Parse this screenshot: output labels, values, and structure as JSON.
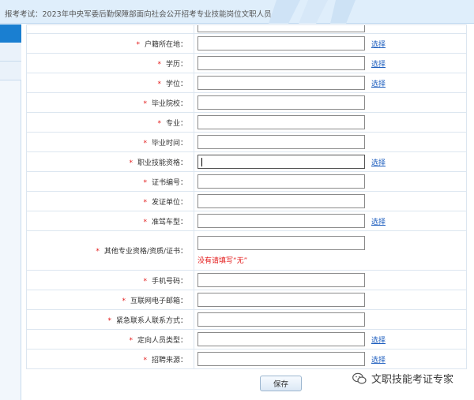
{
  "header": {
    "title": "报考考试：2023年中央军委后勤保障部面向社会公开招考专业技能岗位文职人员"
  },
  "form": {
    "rows": [
      {
        "label": "户籍所在地：",
        "required": true,
        "action": "选择"
      },
      {
        "label": "学历：",
        "required": true,
        "action": "选择"
      },
      {
        "label": "学位：",
        "required": true,
        "action": "选择"
      },
      {
        "label": "毕业院校：",
        "required": true,
        "action": ""
      },
      {
        "label": "专业：",
        "required": true,
        "action": ""
      },
      {
        "label": "毕业时间：",
        "required": true,
        "action": ""
      },
      {
        "label": "职业技能资格：",
        "required": true,
        "action": "选择"
      },
      {
        "label": "证书编号：",
        "required": true,
        "action": ""
      },
      {
        "label": "发证单位：",
        "required": true,
        "action": ""
      },
      {
        "label": "准驾车型：",
        "required": true,
        "action": "选择"
      },
      {
        "label": "其他专业资格/资质/证书：",
        "required": true,
        "action": "",
        "hint": "没有请填写“无”"
      },
      {
        "label": "手机号码：",
        "required": true,
        "action": ""
      },
      {
        "label": "互联网电子邮箱：",
        "required": true,
        "action": ""
      },
      {
        "label": "紧急联系人联系方式：",
        "required": true,
        "action": ""
      },
      {
        "label": "定向人员类型：",
        "required": true,
        "action": "选择"
      },
      {
        "label": "招聘来源：",
        "required": true,
        "action": "选择"
      }
    ],
    "required_mark": "*"
  },
  "actions": {
    "save_label": "保存"
  },
  "watermark": {
    "text": "文职技能考证专家"
  },
  "colors": {
    "accent": "#1a7fd1",
    "required": "#e31919",
    "link": "#1f5fbf",
    "header_bg": "#dfeefb"
  }
}
